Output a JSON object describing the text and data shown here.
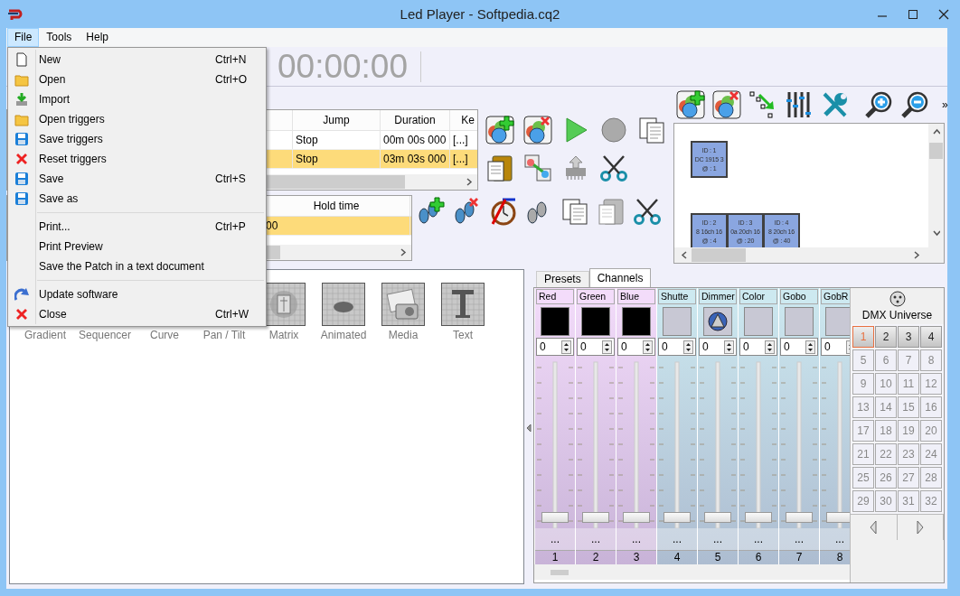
{
  "window": {
    "title": "Led Player - Softpedia.cq2"
  },
  "menu_bar": [
    {
      "label": "File",
      "selected": true
    },
    {
      "label": "Tools",
      "selected": false
    },
    {
      "label": "Help",
      "selected": false
    }
  ],
  "file_menu": [
    {
      "kind": "item",
      "label": "New",
      "shortcut": "Ctrl+N"
    },
    {
      "kind": "item",
      "label": "Open",
      "shortcut": "Ctrl+O"
    },
    {
      "kind": "item",
      "label": "Import"
    },
    {
      "kind": "item",
      "label": "Open triggers"
    },
    {
      "kind": "item",
      "label": "Save triggers"
    },
    {
      "kind": "item",
      "label": "Reset triggers"
    },
    {
      "kind": "item",
      "label": "Save",
      "shortcut": "Ctrl+S"
    },
    {
      "kind": "item",
      "label": "Save as"
    },
    {
      "kind": "separator"
    },
    {
      "kind": "item",
      "label": "Print...",
      "shortcut": "Ctrl+P"
    },
    {
      "kind": "item",
      "label": "Print Preview"
    },
    {
      "kind": "item",
      "label": "Save the Patch in a text document"
    },
    {
      "kind": "separator"
    },
    {
      "kind": "item",
      "label": "Update software"
    },
    {
      "kind": "item",
      "label": "Close",
      "shortcut": "Ctrl+W"
    }
  ],
  "timer": "00:00:00",
  "steps_table": {
    "columns": [
      "Jump",
      "Duration",
      "Ke"
    ],
    "rows": [
      {
        "cells": [
          "Stop",
          "00m 00s 000",
          "[...]"
        ],
        "selected": false
      },
      {
        "cells": [
          "Stop",
          "03m 03s 000",
          "[...]"
        ],
        "selected": true
      }
    ]
  },
  "hold_table": {
    "columns": [
      "Hold time"
    ],
    "rows": [
      {
        "cells": [
          "00"
        ],
        "selected": true
      }
    ]
  },
  "patch": {
    "overflow": "»",
    "fixtures": [
      {
        "id": "ID : 1",
        "model": "DC 1915 3",
        "address": "@ : 1"
      },
      {
        "id": "ID : 2",
        "model": "8 16ch 16",
        "address": "@ : 4"
      },
      {
        "id": "ID : 3",
        "model": "0a 20ch 16",
        "address": "@ : 20"
      },
      {
        "id": "ID : 4",
        "model": "8 20ch 16",
        "address": "@ : 40"
      }
    ]
  },
  "effects": [
    "Gradient",
    "Sequencer",
    "Curve",
    "Pan / Tilt",
    "Matrix",
    "Animated",
    "Media",
    "Text"
  ],
  "channel_tabs": [
    {
      "label": "Presets",
      "selected": false
    },
    {
      "label": "Channels",
      "selected": true
    }
  ],
  "channels": [
    {
      "name": "Red",
      "kind": "rgb",
      "color": "#f3dcfa",
      "value": "0",
      "level": 0,
      "more": "...",
      "number": "1"
    },
    {
      "name": "Green",
      "kind": "rgb",
      "color": "#f3dcfa",
      "value": "0",
      "level": 0,
      "more": "...",
      "number": "2"
    },
    {
      "name": "Blue",
      "kind": "rgb",
      "color": "#f3dcfa",
      "value": "0",
      "level": 0,
      "more": "...",
      "number": "3"
    },
    {
      "name": "Shutte",
      "kind": "plain",
      "color": "#cde9f0",
      "value": "0",
      "level": 0,
      "more": "...",
      "number": "4"
    },
    {
      "name": "Dimmer",
      "kind": "dimmer",
      "color": "#cde9f0",
      "value": "0",
      "level": 0,
      "more": "...",
      "number": "5"
    },
    {
      "name": "Color",
      "kind": "plain",
      "color": "#cde9f0",
      "value": "0",
      "level": 0,
      "more": "...",
      "number": "6"
    },
    {
      "name": "Gobo",
      "kind": "plain",
      "color": "#cde9f0",
      "value": "0",
      "level": 0,
      "more": "...",
      "number": "7"
    },
    {
      "name": "GobR",
      "kind": "plain",
      "color": "#cde9f0",
      "value": "0",
      "level": 0,
      "more": "...",
      "number": "8"
    }
  ],
  "dmx_universe": {
    "title": "DMX Universe",
    "buttons": [
      {
        "label": "1",
        "selected": true,
        "used": true
      },
      {
        "label": "2",
        "selected": false,
        "used": true
      },
      {
        "label": "3",
        "selected": false,
        "used": true
      },
      {
        "label": "4",
        "selected": false,
        "used": true
      },
      {
        "label": "5",
        "selected": false,
        "used": false
      },
      {
        "label": "6",
        "selected": false,
        "used": false
      },
      {
        "label": "7",
        "selected": false,
        "used": false
      },
      {
        "label": "8",
        "selected": false,
        "used": false
      },
      {
        "label": "9",
        "selected": false,
        "used": false
      },
      {
        "label": "10",
        "selected": false,
        "used": false
      },
      {
        "label": "11",
        "selected": false,
        "used": false
      },
      {
        "label": "12",
        "selected": false,
        "used": false
      },
      {
        "label": "13",
        "selected": false,
        "used": false
      },
      {
        "label": "14",
        "selected": false,
        "used": false
      },
      {
        "label": "15",
        "selected": false,
        "used": false
      },
      {
        "label": "16",
        "selected": false,
        "used": false
      },
      {
        "label": "17",
        "selected": false,
        "used": false
      },
      {
        "label": "18",
        "selected": false,
        "used": false
      },
      {
        "label": "19",
        "selected": false,
        "used": false
      },
      {
        "label": "20",
        "selected": false,
        "used": false
      },
      {
        "label": "21",
        "selected": false,
        "used": false
      },
      {
        "label": "22",
        "selected": false,
        "used": false
      },
      {
        "label": "23",
        "selected": false,
        "used": false
      },
      {
        "label": "24",
        "selected": false,
        "used": false
      },
      {
        "label": "25",
        "selected": false,
        "used": false
      },
      {
        "label": "26",
        "selected": false,
        "used": false
      },
      {
        "label": "27",
        "selected": false,
        "used": false
      },
      {
        "label": "28",
        "selected": false,
        "used": false
      },
      {
        "label": "29",
        "selected": false,
        "used": false
      },
      {
        "label": "30",
        "selected": false,
        "used": false
      },
      {
        "label": "31",
        "selected": false,
        "used": false
      },
      {
        "label": "32",
        "selected": false,
        "used": false
      }
    ]
  }
}
